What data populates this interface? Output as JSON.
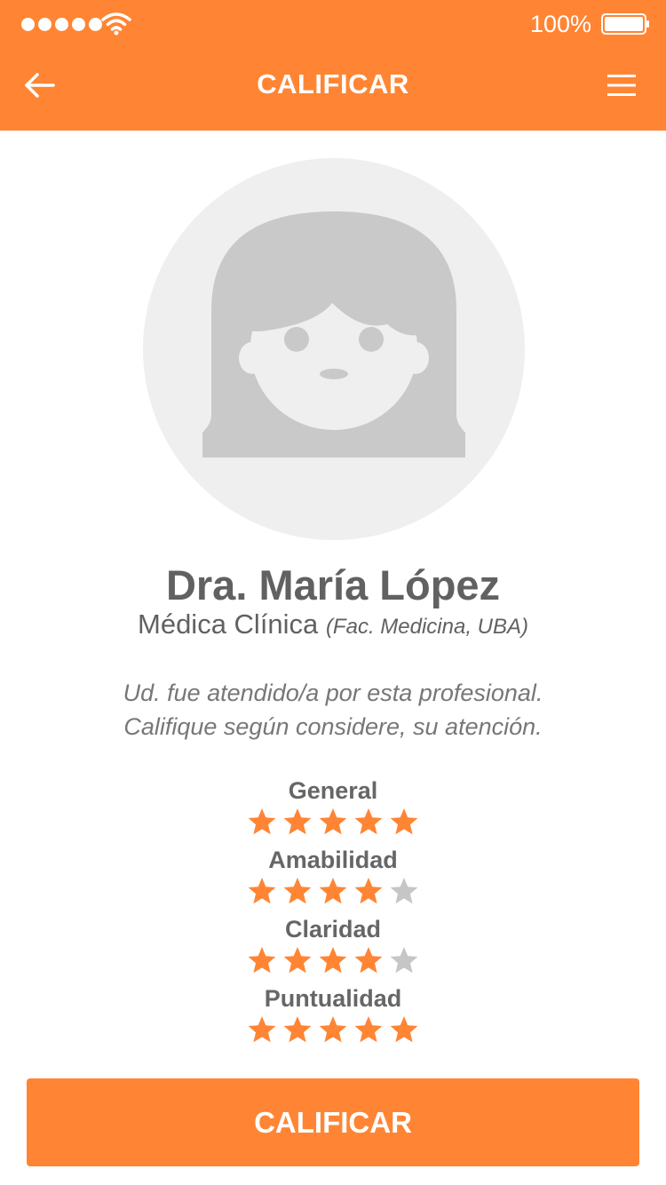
{
  "status_bar": {
    "signal_icon": "signal-dots-icon",
    "wifi_icon": "wifi-icon",
    "battery_percent": "100%",
    "battery_icon": "battery-icon"
  },
  "header": {
    "title": "CALIFICAR",
    "back_icon": "arrow-left-icon",
    "menu_icon": "hamburger-menu-icon"
  },
  "profile": {
    "avatar_icon": "female-avatar-icon",
    "name": "Dra. María López",
    "specialty": "Médica Clínica",
    "faculty": "(Fac. Medicina, UBA)"
  },
  "message": {
    "line1": "Ud. fue atendido/a por esta profesional.",
    "line2": "Califique según considere, su atención."
  },
  "ratings": [
    {
      "label": "General",
      "value": 5,
      "max": 5
    },
    {
      "label": "Amabilidad",
      "value": 4,
      "max": 5
    },
    {
      "label": "Claridad",
      "value": 4,
      "max": 5
    },
    {
      "label": "Puntualidad",
      "value": 5,
      "max": 5
    }
  ],
  "button": {
    "label": "CALIFICAR"
  },
  "colors": {
    "accent": "#ff8534",
    "star_on": "#ff8534",
    "star_off": "#c6c6c6",
    "text_dark": "#616161",
    "text_muted": "#777777",
    "avatar_bg": "#efefef",
    "avatar_fg": "#c9c9c9"
  }
}
